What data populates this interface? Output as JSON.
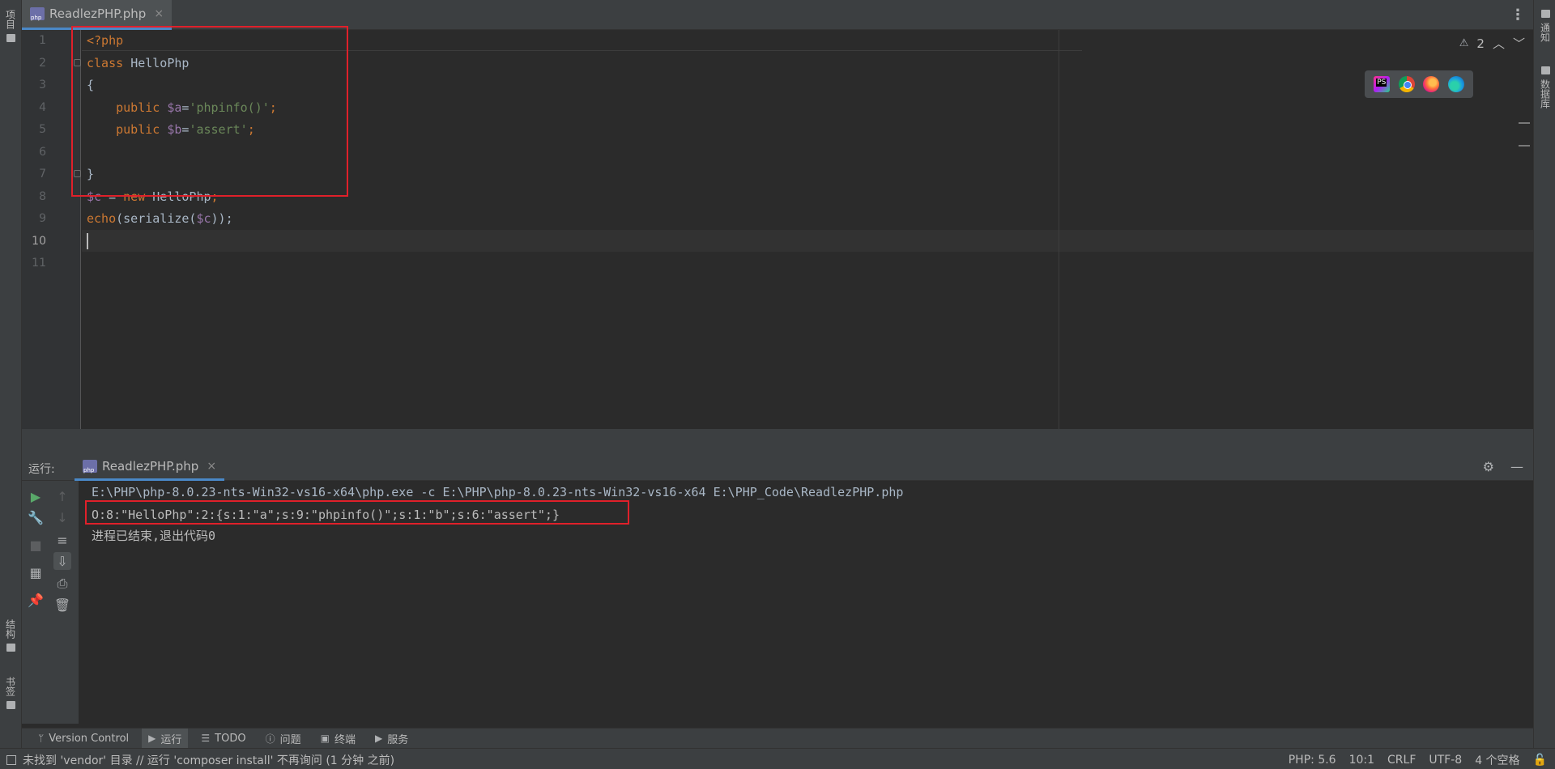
{
  "left_strip": {
    "project_label": "项目",
    "structure_label": "结构",
    "bookmarks_label": "书签"
  },
  "right_strip": {
    "notifications_label": "通知",
    "database_label": "数据库"
  },
  "editor_tab": {
    "filename": "ReadlezPHP.php",
    "close": "×"
  },
  "editor": {
    "line_numbers": [
      "1",
      "2",
      "3",
      "4",
      "5",
      "6",
      "7",
      "8",
      "9",
      "10",
      "11"
    ],
    "warning_count": "2",
    "lines": {
      "l1": "<?php",
      "l2_kw": "class",
      "l2_name": "HelloPhp",
      "l3": "{",
      "l4_kw": "public",
      "l4_var": "$a",
      "l4_eq": "=",
      "l4_str": "'phpinfo()'",
      "l4_semi": ";",
      "l5_kw": "public",
      "l5_var": "$b",
      "l5_eq": "=",
      "l5_str": "'assert'",
      "l5_semi": ";",
      "l7": "}",
      "l8_var": "$c",
      "l8_eq": " = ",
      "l8_kw": "new",
      "l8_name": "HelloPhp",
      "l8_semi": ";",
      "l9_fn": "echo",
      "l9_a": "(serialize(",
      "l9_var": "$c",
      "l9_b": "));"
    }
  },
  "run_panel": {
    "label": "运行:",
    "tab_filename": "ReadlezPHP.php",
    "close": "×",
    "output": {
      "command": "E:\\PHP\\php-8.0.23-nts-Win32-vs16-x64\\php.exe -c E:\\PHP\\php-8.0.23-nts-Win32-vs16-x64 E:\\PHP_Code\\ReadlezPHP.php",
      "result": "O:8:\"HelloPhp\":2:{s:1:\"a\";s:9:\"phpinfo()\";s:1:\"b\";s:6:\"assert\";}",
      "exit": "进程已结束,退出代码0"
    }
  },
  "tool_windows": [
    {
      "label": "Version Control",
      "icon": "branch-icon"
    },
    {
      "label": "运行",
      "icon": "play-icon"
    },
    {
      "label": "TODO",
      "icon": "list-icon"
    },
    {
      "label": "问题",
      "icon": "info-icon"
    },
    {
      "label": "终端",
      "icon": "terminal-icon"
    },
    {
      "label": "服务",
      "icon": "services-icon"
    }
  ],
  "status_bar": {
    "message": "未找到 'vendor' 目录 // 运行 'composer install'   不再询问 (1 分钟 之前)",
    "php_version": "PHP: 5.6",
    "position": "10:1",
    "line_sep": "CRLF",
    "encoding": "UTF-8",
    "indent": "4 个空格"
  },
  "colors": {
    "keyword": "#cc7832",
    "variable": "#9876aa",
    "string": "#6a8759",
    "highlight_box": "#e0202a"
  }
}
